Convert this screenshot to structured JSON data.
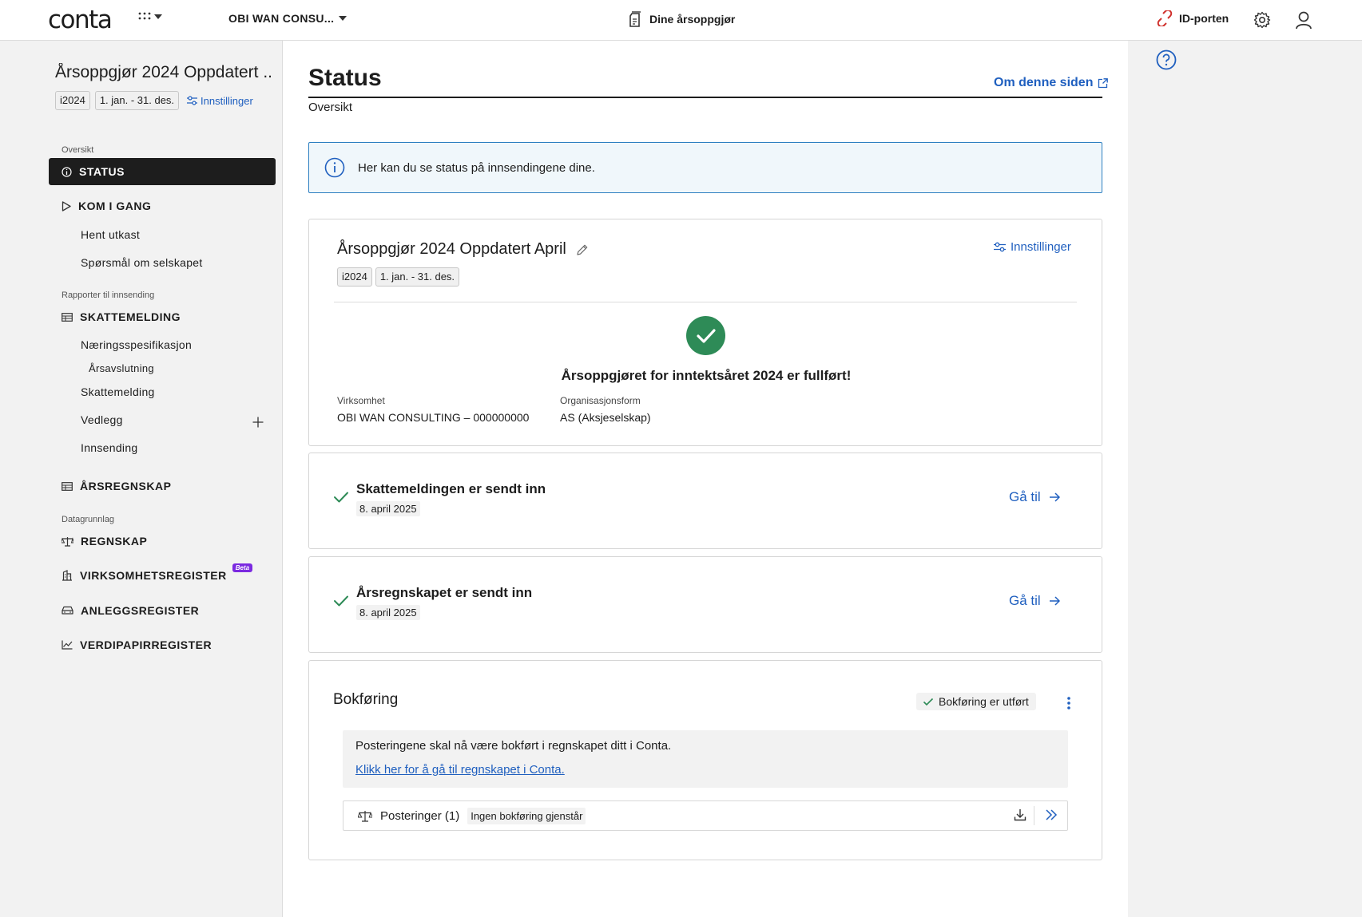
{
  "topbar": {
    "logo": "conta",
    "company": "OBI WAN CONSU...",
    "docs_link": "Dine årsoppgjør",
    "idporten": "ID-porten"
  },
  "sidebar": {
    "title": "Årsoppgjør 2024 Oppdatert ...",
    "tag_year": "i2024",
    "tag_period": "1. jan. - 31. des.",
    "settings_link": "Innstillinger",
    "section_oversikt": "Oversikt",
    "status": "STATUS",
    "kom_i_gang": "KOM I GANG",
    "hent_utkast": "Hent utkast",
    "sporsmal": "Spørsmål om selskapet",
    "section_rapporter": "Rapporter til innsending",
    "skattemelding_main": "SKATTEMELDING",
    "naeringsspesifikasjon": "Næringsspesifikasjon",
    "arsavslutning": "Årsavslutning",
    "skattemelding_sub": "Skattemelding",
    "vedlegg": "Vedlegg",
    "innsending": "Innsending",
    "arsregnskap": "ÅRSREGNSKAP",
    "section_datagrunnlag": "Datagrunnlag",
    "regnskap": "REGNSKAP",
    "virksomhetsregister": "VIRKSOMHETSREGISTER",
    "beta": "Beta",
    "anleggsregister": "ANLEGGSREGISTER",
    "verdipapirregister": "VERDIPAPIRREGISTER"
  },
  "main": {
    "title": "Status",
    "about_link": "Om denne siden",
    "subtitle": "Oversikt",
    "info": "Her kan du se status på innsendingene dine.",
    "summary": {
      "title": "Årsoppgjør 2024 Oppdatert April",
      "tag_year": "i2024",
      "tag_period": "1. jan. - 31. des.",
      "settings": "Innstillinger",
      "completed_msg": "Årsoppgjøret for inntektsåret 2024 er fullført!",
      "virksomhet_label": "Virksomhet",
      "virksomhet_value": "OBI WAN CONSULTING – 000000000",
      "orgform_label": "Organisasjonsform",
      "orgform_value": "AS (Aksjeselskap)"
    },
    "skattemelding": {
      "title": "Skattemeldingen er sendt inn",
      "date": "8. april 2025",
      "goto": "Gå til"
    },
    "arsregnskap": {
      "title": "Årsregnskapet er sendt inn",
      "date": "8. april 2025",
      "goto": "Gå til"
    },
    "bokforing": {
      "title": "Bokføring",
      "status": "Bokføring er utført",
      "note": "Posteringene skal nå være bokført i regnskapet ditt i Conta.",
      "note_link": "Klikk her for å gå til regnskapet i Conta.",
      "posteringer": "Posteringer (1)",
      "badge": "Ingen bokføring gjenstår"
    }
  },
  "colors": {
    "accent": "#1f5fbf",
    "success": "#2e8b57",
    "id_porten": "#d0312d",
    "beta": "#7b2ae0"
  },
  "icons": [
    "apps-grid-icon",
    "chevron-down-icon",
    "document-icon",
    "id-porten-icon",
    "gear-icon",
    "user-icon",
    "info-icon",
    "play-icon",
    "table-icon",
    "scale-icon",
    "building-icon",
    "car-icon",
    "chart-icon",
    "plus-icon",
    "external-link-icon",
    "pencil-icon",
    "sliders-icon",
    "check-icon",
    "arrow-right-icon",
    "kebab-icon",
    "download-icon",
    "double-chevron-icon",
    "help-icon"
  ]
}
